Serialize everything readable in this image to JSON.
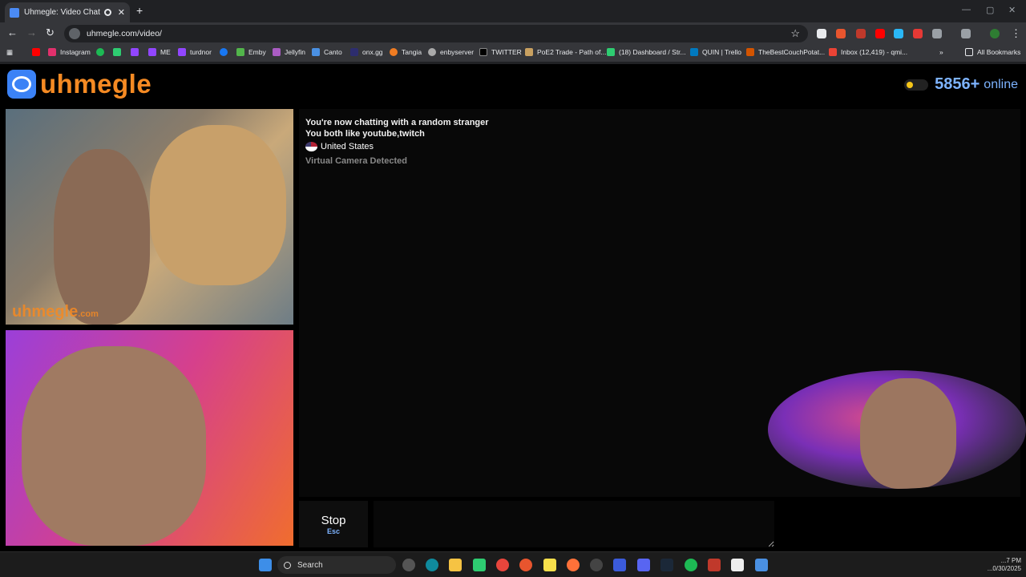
{
  "browser": {
    "tab_title": "Uhmegle: Video Chat | Ran...",
    "tab_close": "✕",
    "new_tab": "+",
    "url": "uhmegle.com/video/",
    "bookmarks": [
      {
        "label": "Instagram",
        "color": "#e1306c"
      },
      {
        "label": "ME",
        "color": "#9146ff"
      },
      {
        "label": "turdnor",
        "color": "#9146ff"
      },
      {
        "label": "Emby",
        "color": "#52b54b"
      },
      {
        "label": "Jellyfin",
        "color": "#aa5cc3"
      },
      {
        "label": "Canto",
        "color": "#4a90e2"
      },
      {
        "label": "onx.gg",
        "color": "#2d2d6e"
      },
      {
        "label": "Tangia",
        "color": "#f07c22"
      },
      {
        "label": "enbyserver",
        "color": "#aaaaaa"
      },
      {
        "label": "TWITTER",
        "color": "#000000"
      },
      {
        "label": "PoE2 Trade - Path of...",
        "color": "#c8a060"
      },
      {
        "label": "(18) Dashboard / Str...",
        "color": "#2ecc71"
      },
      {
        "label": "QUIN | Trello",
        "color": "#0079bf"
      },
      {
        "label": "TheBestCouchPotat...",
        "color": "#d35400"
      },
      {
        "label": "Inbox (12,419) - qmi...",
        "color": "#ea4335"
      }
    ],
    "all_bookmarks": "All Bookmarks"
  },
  "site": {
    "logo_text": "uhmegle",
    "online_count": "5856+",
    "online_label": "online"
  },
  "video": {
    "watermark": "uhmegle",
    "watermark_suffix": ".com"
  },
  "chat": {
    "line1": "You're now chatting with a random stranger",
    "line2": "You both like youtube,twitch",
    "country": "United States",
    "notice": "Virtual Camera Detected"
  },
  "controls": {
    "stop_label": "Stop",
    "stop_key": "Esc"
  },
  "taskbar": {
    "search_placeholder": "Search",
    "time": "...7 PM",
    "date": "...0/30/2025"
  }
}
